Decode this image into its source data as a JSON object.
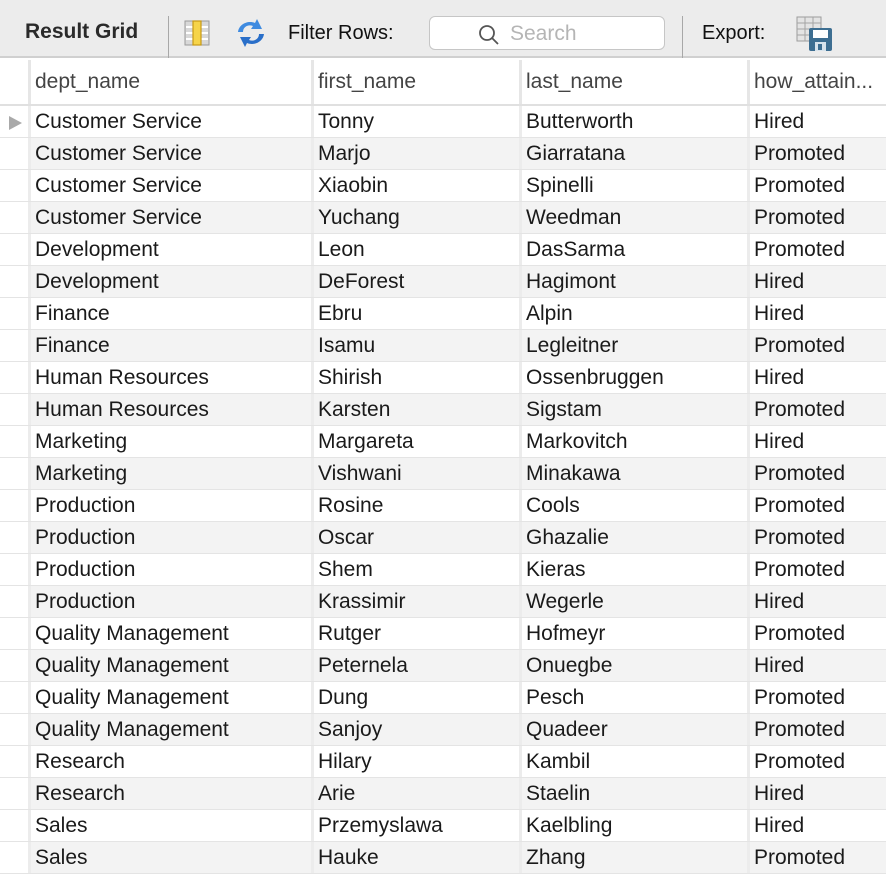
{
  "toolbar": {
    "title": "Result Grid",
    "grid_icon": "form-grid-icon",
    "refresh_icon": "refresh-icon",
    "filter_label": "Filter Rows:",
    "search_placeholder": "Search",
    "search_value": "",
    "export_label": "Export:",
    "export_icon": "export-save-icon"
  },
  "grid": {
    "columns": [
      "dept_name",
      "first_name",
      "last_name",
      "how_attain..."
    ],
    "selected_row": 0,
    "rows": [
      {
        "dept_name": "Customer Service",
        "first_name": "Tonny",
        "last_name": "Butterworth",
        "how_attained": "Hired"
      },
      {
        "dept_name": "Customer Service",
        "first_name": "Marjo",
        "last_name": "Giarratana",
        "how_attained": "Promoted"
      },
      {
        "dept_name": "Customer Service",
        "first_name": "Xiaobin",
        "last_name": "Spinelli",
        "how_attained": "Promoted"
      },
      {
        "dept_name": "Customer Service",
        "first_name": "Yuchang",
        "last_name": "Weedman",
        "how_attained": "Promoted"
      },
      {
        "dept_name": "Development",
        "first_name": "Leon",
        "last_name": "DasSarma",
        "how_attained": "Promoted"
      },
      {
        "dept_name": "Development",
        "first_name": "DeForest",
        "last_name": "Hagimont",
        "how_attained": "Hired"
      },
      {
        "dept_name": "Finance",
        "first_name": "Ebru",
        "last_name": "Alpin",
        "how_attained": "Hired"
      },
      {
        "dept_name": "Finance",
        "first_name": "Isamu",
        "last_name": "Legleitner",
        "how_attained": "Promoted"
      },
      {
        "dept_name": "Human Resources",
        "first_name": "Shirish",
        "last_name": "Ossenbruggen",
        "how_attained": "Hired"
      },
      {
        "dept_name": "Human Resources",
        "first_name": "Karsten",
        "last_name": "Sigstam",
        "how_attained": "Promoted"
      },
      {
        "dept_name": "Marketing",
        "first_name": "Margareta",
        "last_name": "Markovitch",
        "how_attained": "Hired"
      },
      {
        "dept_name": "Marketing",
        "first_name": "Vishwani",
        "last_name": "Minakawa",
        "how_attained": "Promoted"
      },
      {
        "dept_name": "Production",
        "first_name": "Rosine",
        "last_name": "Cools",
        "how_attained": "Promoted"
      },
      {
        "dept_name": "Production",
        "first_name": "Oscar",
        "last_name": "Ghazalie",
        "how_attained": "Promoted"
      },
      {
        "dept_name": "Production",
        "first_name": "Shem",
        "last_name": "Kieras",
        "how_attained": "Promoted"
      },
      {
        "dept_name": "Production",
        "first_name": "Krassimir",
        "last_name": "Wegerle",
        "how_attained": "Hired"
      },
      {
        "dept_name": "Quality Management",
        "first_name": "Rutger",
        "last_name": "Hofmeyr",
        "how_attained": "Promoted"
      },
      {
        "dept_name": "Quality Management",
        "first_name": "Peternela",
        "last_name": "Onuegbe",
        "how_attained": "Hired"
      },
      {
        "dept_name": "Quality Management",
        "first_name": "Dung",
        "last_name": "Pesch",
        "how_attained": "Promoted"
      },
      {
        "dept_name": "Quality Management",
        "first_name": "Sanjoy",
        "last_name": "Quadeer",
        "how_attained": "Promoted"
      },
      {
        "dept_name": "Research",
        "first_name": "Hilary",
        "last_name": "Kambil",
        "how_attained": "Promoted"
      },
      {
        "dept_name": "Research",
        "first_name": "Arie",
        "last_name": "Staelin",
        "how_attained": "Hired"
      },
      {
        "dept_name": "Sales",
        "first_name": "Przemyslawa",
        "last_name": "Kaelbling",
        "how_attained": "Hired"
      },
      {
        "dept_name": "Sales",
        "first_name": "Hauke",
        "last_name": "Zhang",
        "how_attained": "Promoted"
      }
    ]
  }
}
